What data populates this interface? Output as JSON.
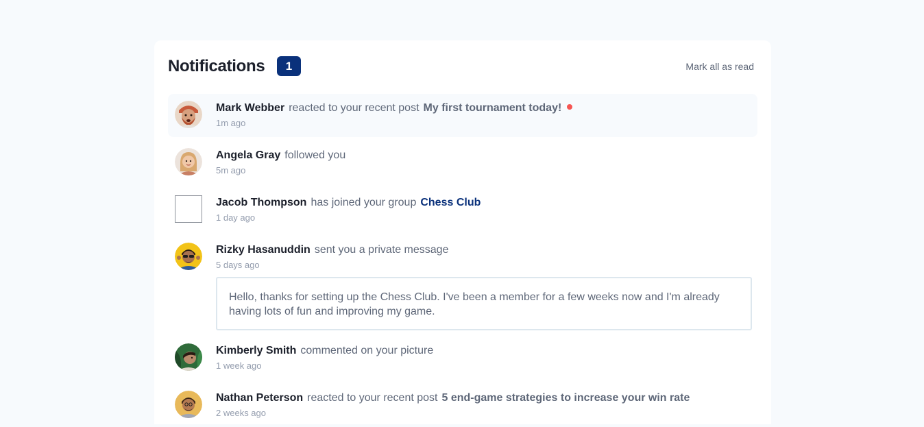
{
  "header": {
    "title": "Notifications",
    "unread_count": "1",
    "mark_all_label": "Mark all as read"
  },
  "notifications": [
    {
      "name": "Mark Webber",
      "action": "reacted to your recent post",
      "target": "My first tournament today!",
      "time": "1m ago",
      "unread": true
    },
    {
      "name": "Angela Gray",
      "action": "followed you",
      "time": "5m ago",
      "unread": false
    },
    {
      "name": "Jacob Thompson",
      "action": "has joined your group",
      "target": "Chess Club",
      "time": "1 day ago",
      "unread": false
    },
    {
      "name": "Rizky Hasanuddin",
      "action": "sent you a private message",
      "time": "5 days ago",
      "message": "Hello, thanks for setting up the Chess Club. I've been a member for a few weeks now and I'm already having lots of fun and improving my game.",
      "unread": false
    },
    {
      "name": "Kimberly Smith",
      "action": "commented on your picture",
      "time": "1 week ago",
      "unread": false
    },
    {
      "name": "Nathan Peterson",
      "action": "reacted to your recent post",
      "target": "5 end-game strategies to increase your win rate",
      "time": "2 weeks ago",
      "unread": false
    }
  ],
  "colors": {
    "page_background": "#f7fafd",
    "card_background": "#ffffff",
    "badge_blue": "#0a317b",
    "unread_dot": "#f65552",
    "heading_text": "#1c202b",
    "body_text": "#5e6778",
    "muted_text": "#939cad",
    "message_border": "#dde7ee"
  }
}
